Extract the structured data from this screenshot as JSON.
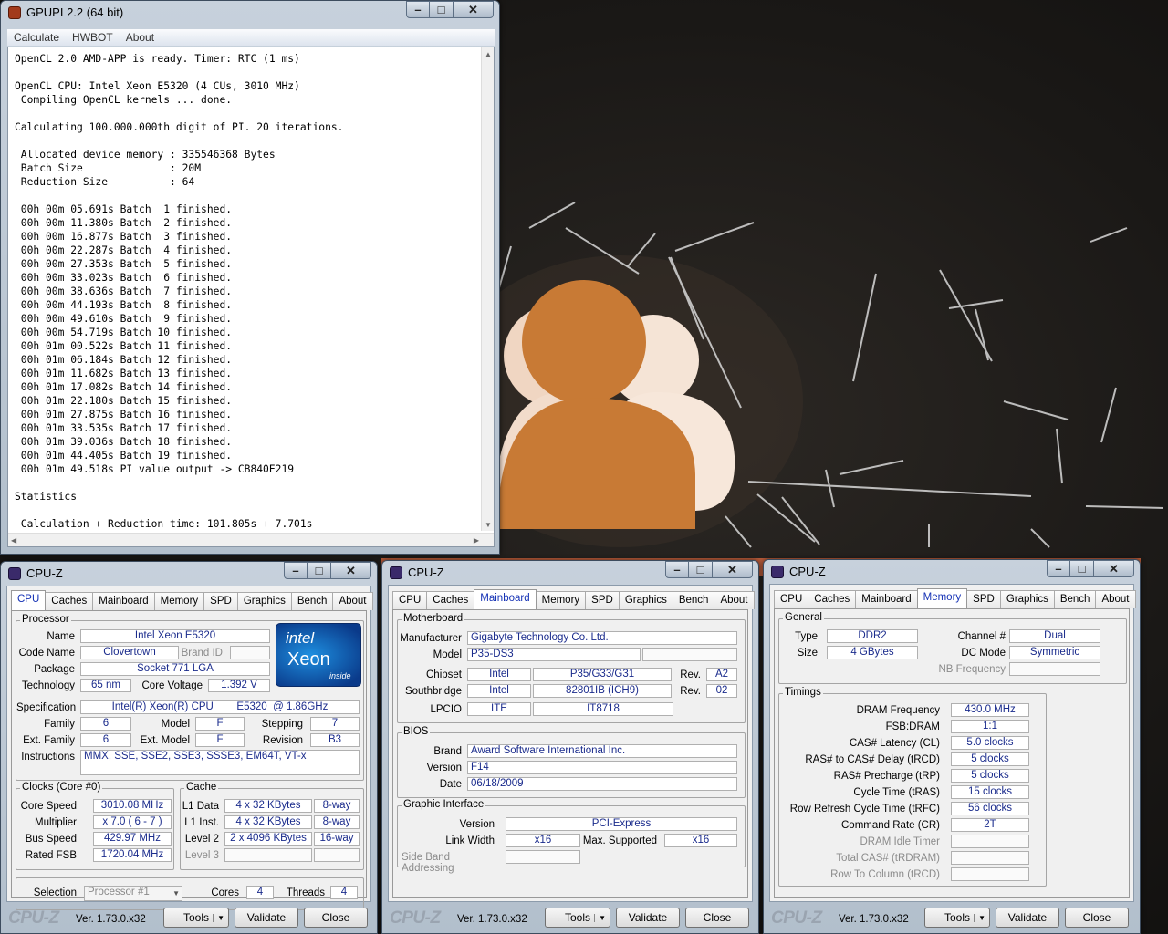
{
  "gpupi": {
    "title": "GPUPI 2.2 (64 bit)",
    "menu": [
      "Calculate",
      "HWBOT",
      "About"
    ],
    "console": "OpenCL 2.0 AMD-APP is ready. Timer: RTC (1 ms)\n\nOpenCL CPU: Intel Xeon E5320 (4 CUs, 3010 MHz)\n Compiling OpenCL kernels ... done.\n\nCalculating 100.000.000th digit of PI. 20 iterations.\n\n Allocated device memory : 335546368 Bytes\n Batch Size              : 20M\n Reduction Size          : 64\n\n 00h 00m 05.691s Batch  1 finished.\n 00h 00m 11.380s Batch  2 finished.\n 00h 00m 16.877s Batch  3 finished.\n 00h 00m 22.287s Batch  4 finished.\n 00h 00m 27.353s Batch  5 finished.\n 00h 00m 33.023s Batch  6 finished.\n 00h 00m 38.636s Batch  7 finished.\n 00h 00m 44.193s Batch  8 finished.\n 00h 00m 49.610s Batch  9 finished.\n 00h 00m 54.719s Batch 10 finished.\n 00h 01m 00.522s Batch 11 finished.\n 00h 01m 06.184s Batch 12 finished.\n 00h 01m 11.682s Batch 13 finished.\n 00h 01m 17.082s Batch 14 finished.\n 00h 01m 22.180s Batch 15 finished.\n 00h 01m 27.875s Batch 16 finished.\n 00h 01m 33.535s Batch 17 finished.\n 00h 01m 39.036s Batch 18 finished.\n 00h 01m 44.405s Batch 19 finished.\n 00h 01m 49.518s PI value output -> CB840E219\n\nStatistics\n\n Calculation + Reduction time: 101.805s + 7.701s"
  },
  "cpuz_common": {
    "title": "CPU-Z",
    "tabs": [
      "CPU",
      "Caches",
      "Mainboard",
      "Memory",
      "SPD",
      "Graphics",
      "Bench",
      "About"
    ],
    "logo": "CPU-Z",
    "version": "Ver. 1.73.0.x32",
    "tools": "Tools",
    "validate": "Validate",
    "close": "Close",
    "dropdown_arrow": "▼"
  },
  "cpu": {
    "processor_label": "Processor",
    "name_label": "Name",
    "name": "Intel Xeon E5320",
    "codename_label": "Code Name",
    "codename": "Clovertown",
    "brandid_label": "Brand ID",
    "package_label": "Package",
    "package": "Socket 771 LGA",
    "technology_label": "Technology",
    "technology": "65 nm",
    "corevoltage_label": "Core Voltage",
    "corevoltage": "1.392 V",
    "spec_label": "Specification",
    "spec": "Intel(R) Xeon(R) CPU        E5320  @ 1.86GHz",
    "family_label": "Family",
    "family": "6",
    "model_label": "Model",
    "model": "F",
    "stepping_label": "Stepping",
    "stepping": "7",
    "extfamily_label": "Ext. Family",
    "extfamily": "6",
    "extmodel_label": "Ext. Model",
    "extmodel": "F",
    "revision_label": "Revision",
    "revision": "B3",
    "instr_label": "Instructions",
    "instr": "MMX, SSE, SSE2, SSE3, SSSE3, EM64T, VT-x",
    "clocks_label": "Clocks (Core #0)",
    "corespeed_label": "Core Speed",
    "corespeed": "3010.08 MHz",
    "multiplier_label": "Multiplier",
    "multiplier": "x 7.0 ( 6 - 7 )",
    "busspeed_label": "Bus Speed",
    "busspeed": "429.97 MHz",
    "ratedfsb_label": "Rated FSB",
    "ratedfsb": "1720.04 MHz",
    "cache_label": "Cache",
    "l1d_label": "L1 Data",
    "l1d": "4 x 32 KBytes",
    "l1d_way": "8-way",
    "l1i_label": "L1 Inst.",
    "l1i": "4 x 32 KBytes",
    "l1i_way": "8-way",
    "l2_label": "Level 2",
    "l2": "2 x 4096 KBytes",
    "l2_way": "16-way",
    "l3_label": "Level 3",
    "selection_label": "Selection",
    "selection": "Processor #1",
    "cores_label": "Cores",
    "cores": "4",
    "threads_label": "Threads",
    "threads": "4",
    "logo_intel": "intel",
    "logo_xeon": "Xeon",
    "logo_inside": "inside"
  },
  "mainboard": {
    "mb_label": "Motherboard",
    "manufacturer_label": "Manufacturer",
    "manufacturer": "Gigabyte Technology Co. Ltd.",
    "model_label": "Model",
    "model": "P35-DS3",
    "chipset_label": "Chipset",
    "chipset_vendor": "Intel",
    "chipset": "P35/G33/G31",
    "rev_label": "Rev.",
    "chipset_rev": "A2",
    "southbridge_label": "Southbridge",
    "sb_vendor": "Intel",
    "sb": "82801IB (ICH9)",
    "sb_rev": "02",
    "lpcio_label": "LPCIO",
    "lpcio_vendor": "ITE",
    "lpcio": "IT8718",
    "bios_label": "BIOS",
    "brand_label": "Brand",
    "brand": "Award Software International Inc.",
    "version_label": "Version",
    "version": "F14",
    "date_label": "Date",
    "date": "06/18/2009",
    "gi_label": "Graphic Interface",
    "gi_version_label": "Version",
    "gi_version": "PCI-Express",
    "linkwidth_label": "Link Width",
    "linkwidth": "x16",
    "maxsupp_label": "Max. Supported",
    "maxsupp": "x16",
    "sideband_label": "Side Band Addressing"
  },
  "memory": {
    "general_label": "General",
    "type_label": "Type",
    "type": "DDR2",
    "size_label": "Size",
    "size": "4 GBytes",
    "channel_label": "Channel #",
    "channel": "Dual",
    "dcmode_label": "DC Mode",
    "dcmode": "Symmetric",
    "nbfreq_label": "NB Frequency",
    "timings_label": "Timings",
    "rows": [
      {
        "label": "DRAM Frequency",
        "value": "430.0 MHz",
        "dis": false
      },
      {
        "label": "FSB:DRAM",
        "value": "1:1",
        "dis": false
      },
      {
        "label": "CAS# Latency (CL)",
        "value": "5.0 clocks",
        "dis": false
      },
      {
        "label": "RAS# to CAS# Delay (tRCD)",
        "value": "5 clocks",
        "dis": false
      },
      {
        "label": "RAS# Precharge (tRP)",
        "value": "5 clocks",
        "dis": false
      },
      {
        "label": "Cycle Time (tRAS)",
        "value": "15 clocks",
        "dis": false
      },
      {
        "label": "Row Refresh Cycle Time (tRFC)",
        "value": "56 clocks",
        "dis": false
      },
      {
        "label": "Command Rate (CR)",
        "value": "2T",
        "dis": false
      },
      {
        "label": "DRAM Idle Timer",
        "value": "",
        "dis": true
      },
      {
        "label": "Total CAS# (tRDRAM)",
        "value": "",
        "dis": true
      },
      {
        "label": "Row To Column (tRCD)",
        "value": "",
        "dis": true
      }
    ]
  },
  "colors": {
    "accent_tab": "#1431b5",
    "value_text": "#1a2b8c",
    "wallpaper_figure_front": "#c87a35",
    "wallpaper_figure_back": "#f0d8c4"
  }
}
